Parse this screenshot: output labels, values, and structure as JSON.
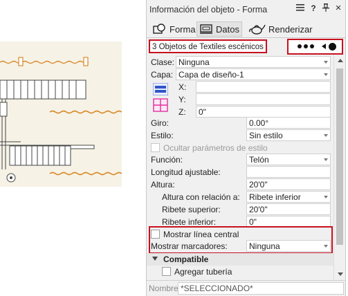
{
  "window": {
    "title": "Información del objeto - Forma",
    "menu_icon": "hamburger-menu-icon",
    "help_label": "?",
    "pin_icon": "pin-icon",
    "close_label": "×"
  },
  "tabs": [
    {
      "label": "Forma",
      "icon": "shape-icon"
    },
    {
      "label": "Datos",
      "icon": "data-icon"
    },
    {
      "label": "Renderizar",
      "icon": "teapot-icon"
    }
  ],
  "selection": {
    "text": "3 Objetos de Textiles escénicos"
  },
  "properties": {
    "clase_label": "Clase:",
    "clase_value": "Ninguna",
    "capa_label": "Capa:",
    "capa_value": "Capa de diseño-1",
    "x_label": "X:",
    "x_value": "",
    "y_label": "Y:",
    "y_value": "",
    "z_label": "Z:",
    "z_value": "0\"",
    "giro_label": "Giro:",
    "giro_value": "0.00°",
    "estilo_label": "Estilo:",
    "estilo_value": "Sin estilo",
    "ocultar_label": "Ocultar parámetros de estilo",
    "funcion_label": "Función:",
    "funcion_value": "Telón",
    "longitud_label": "Longitud ajustable:",
    "longitud_value": "",
    "altura_label": "Altura:",
    "altura_value": "20'0\"",
    "altura_rel_label": "Altura con relación a:",
    "altura_rel_value": "Ribete inferior",
    "ribete_sup_label": "Ribete superior:",
    "ribete_sup_value": "20'0\"",
    "ribete_inf_label": "Ribete inferior:",
    "ribete_inf_value": "0\"",
    "mostrar_linea_label": "Mostrar línea central",
    "mostrar_marcadores_label": "Mostrar marcadores:",
    "mostrar_marcadores_value": "Ninguna",
    "compatible_label": "Compatible",
    "agregar_label": "Agregar tubería"
  },
  "footer": {
    "nombre_label": "Nombre:",
    "nombre_value": "*SELECCIONADO*"
  },
  "colors": {
    "highlight": "#c8101e",
    "drape": "#d98a2b",
    "drawing_bg": "#f6f2e6"
  }
}
